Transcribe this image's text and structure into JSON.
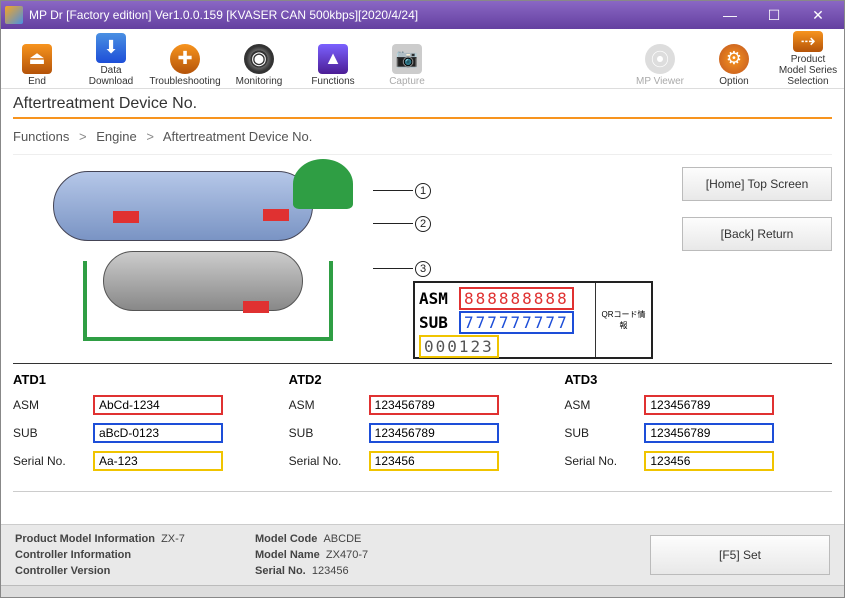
{
  "window": {
    "title": "MP Dr [Factory edition] Ver1.0.0.159 [KVASER CAN 500kbps][2020/4/24]"
  },
  "toolbar": {
    "end": "End",
    "data_download": "Data Download",
    "troubleshooting": "Troubleshooting",
    "monitoring": "Monitoring",
    "functions": "Functions",
    "capture": "Capture",
    "mp_viewer": "MP Viewer",
    "option": "Option",
    "selection": "Product Model Series Selection"
  },
  "page": {
    "title": "Aftertreatment Device No."
  },
  "breadcrumb": {
    "item1": "Functions",
    "item2": "Engine",
    "item3": "Aftertreatment Device No."
  },
  "side_buttons": {
    "home": "[Home] Top Screen",
    "back": "[Back] Return"
  },
  "plate": {
    "asm_label": "ASM",
    "asm_value": "888888888",
    "sub_label": "SUB",
    "sub_value": "777777777",
    "serial_value": "000123",
    "qr_label": "QRコード情報"
  },
  "callouts": {
    "c1": "1",
    "c2": "2",
    "c3": "3"
  },
  "atd": {
    "columns": [
      {
        "title": "ATD1",
        "asm_label": "ASM",
        "asm_value": "AbCd-1234",
        "sub_label": "SUB",
        "sub_value": "aBcD-0123",
        "serial_label": "Serial No.",
        "serial_value": "Aa-123"
      },
      {
        "title": "ATD2",
        "asm_label": "ASM",
        "asm_value": "123456789",
        "sub_label": "SUB",
        "sub_value": "123456789",
        "serial_label": "Serial No.",
        "serial_value": "123456"
      },
      {
        "title": "ATD3",
        "asm_label": "ASM",
        "asm_value": "123456789",
        "sub_label": "SUB",
        "sub_value": "123456789",
        "serial_label": "Serial No.",
        "serial_value": "123456"
      }
    ]
  },
  "footer": {
    "product_model_info_label": "Product Model Information",
    "product_model_info_value": "ZX-7",
    "controller_info_label": "Controller Information",
    "controller_info_value": "",
    "controller_version_label": "Controller Version",
    "controller_version_value": "",
    "model_code_label": "Model Code",
    "model_code_value": "ABCDE",
    "model_name_label": "Model Name",
    "model_name_value": "ZX470-7",
    "serial_no_label": "Serial No.",
    "serial_no_value": "123456",
    "set_button": "[F5] Set"
  }
}
